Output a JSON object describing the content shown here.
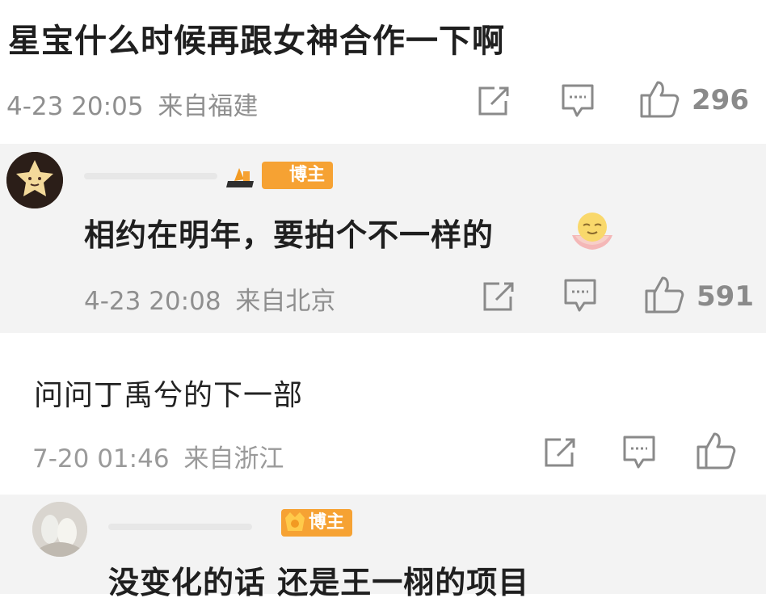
{
  "comments": [
    {
      "text": "星宝什么时候再跟女神合作一下啊",
      "time": "4-23 20:05",
      "location": "来自福建",
      "like_count": "296"
    },
    {
      "badge": "博主",
      "text": "相约在明年，要拍个不一样的",
      "emoji": "smiling-face-emoji",
      "time": "4-23 20:08",
      "location": "来自北京",
      "like_count": "591"
    },
    {
      "text": "问问丁禹兮的下一部",
      "time": "7-20 01:46",
      "location": "来自浙江",
      "like_count": ""
    },
    {
      "badge": "博主",
      "text": "没变化的话 还是王一栩的项目"
    }
  ],
  "icons": [
    "share-icon",
    "comment-icon",
    "like-icon"
  ],
  "colors": {
    "badge": "#f6a233",
    "meta": "#8f8f8f",
    "reply_bg": "#f3f3f3"
  }
}
